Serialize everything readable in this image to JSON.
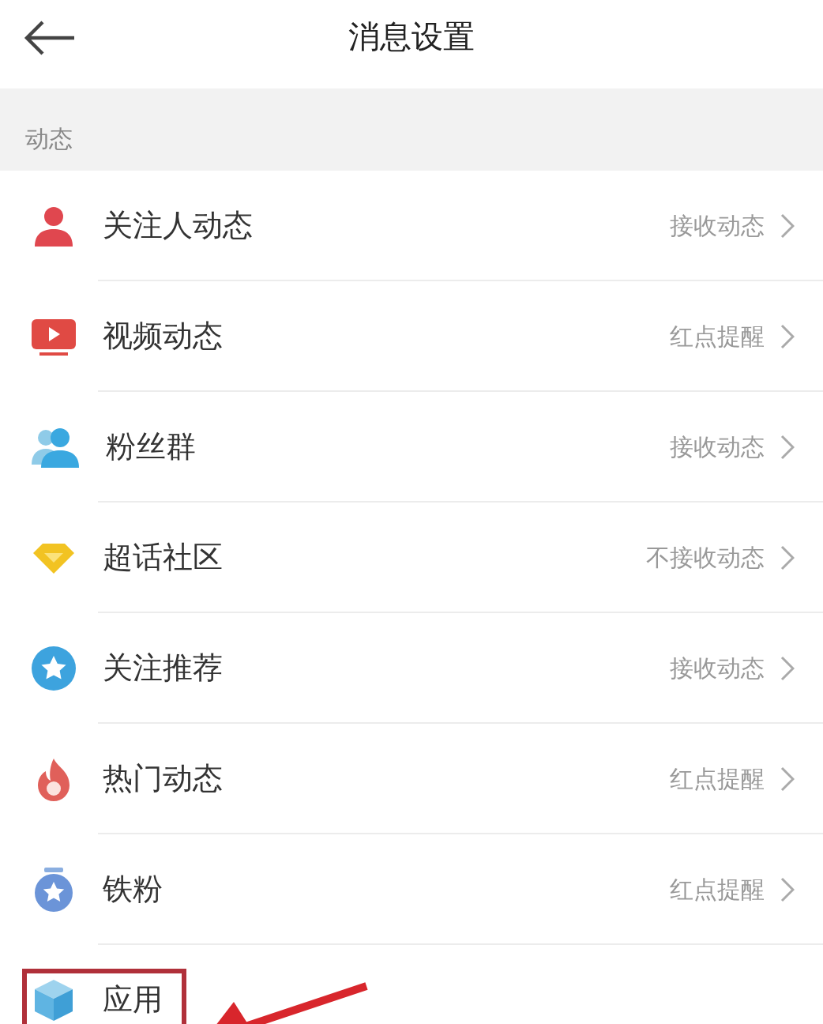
{
  "header": {
    "title": "消息设置"
  },
  "section": {
    "title": "动态"
  },
  "rows": [
    {
      "label": "关注人动态",
      "value": "接收动态",
      "highlighted": false
    },
    {
      "label": "视频动态",
      "value": "红点提醒",
      "highlighted": false
    },
    {
      "label": "粉丝群",
      "value": "接收动态",
      "highlighted": false
    },
    {
      "label": "超话社区",
      "value": "不接收动态",
      "highlighted": false
    },
    {
      "label": "关注推荐",
      "value": "接收动态",
      "highlighted": false
    },
    {
      "label": "热门动态",
      "value": "红点提醒",
      "highlighted": false
    },
    {
      "label": "铁粉",
      "value": "红点提醒",
      "highlighted": false
    },
    {
      "label": "应用",
      "highlighted": true
    }
  ]
}
